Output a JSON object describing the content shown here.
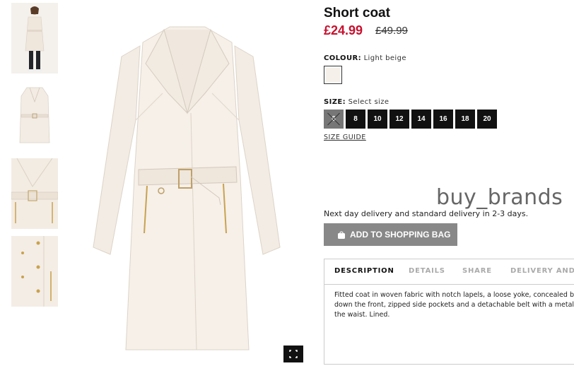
{
  "product": {
    "title": "Short coat",
    "price": "£24.99",
    "old_price": "£49.99"
  },
  "colour": {
    "label": "COLOUR:",
    "value": "Light beige",
    "swatch_color": "#f6f0ea"
  },
  "size": {
    "label": "SIZE:",
    "value": "Select size",
    "options": [
      "6",
      "8",
      "10",
      "12",
      "14",
      "16",
      "18",
      "20"
    ],
    "unavailable": [
      "6"
    ],
    "guide_label": "SIZE GUIDE"
  },
  "watermark": "buy_brands",
  "delivery_text": "Next day delivery and standard delivery in 2-3 days.",
  "add_to_bag_label": "ADD TO SHOPPING BAG",
  "tabs": [
    {
      "label": "DESCRIPTION",
      "active": true
    },
    {
      "label": "DETAILS",
      "active": false
    },
    {
      "label": "SHARE",
      "active": false
    },
    {
      "label": "DELIVERY AND P",
      "active": false
    }
  ],
  "description_lines": [
    "Fitted coat in woven fabric with notch lapels, a loose yoke, concealed b",
    "down the front, zipped side pockets and a detachable belt with a metal",
    "the waist. Lined."
  ],
  "icons": {
    "expand": "expand-icon",
    "bag": "shopping-bag-icon"
  },
  "colors": {
    "price_red": "#c8102e",
    "button_grey": "#888888",
    "size_black": "#111111"
  }
}
